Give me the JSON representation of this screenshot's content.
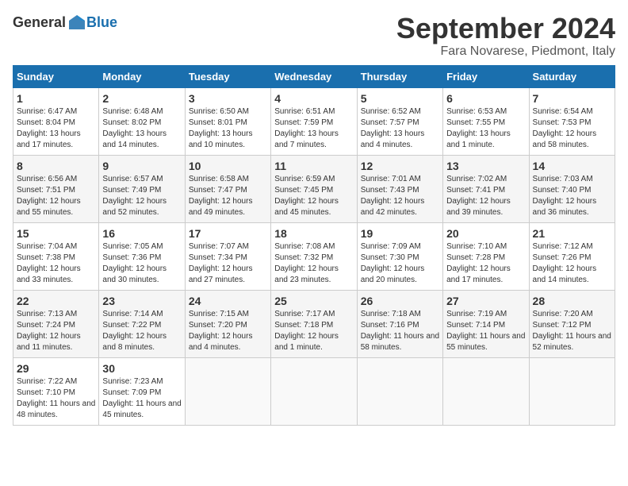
{
  "header": {
    "logo_general": "General",
    "logo_blue": "Blue",
    "month": "September 2024",
    "location": "Fara Novarese, Piedmont, Italy"
  },
  "columns": [
    "Sunday",
    "Monday",
    "Tuesday",
    "Wednesday",
    "Thursday",
    "Friday",
    "Saturday"
  ],
  "weeks": [
    [
      {
        "day": "1",
        "sunrise": "6:47 AM",
        "sunset": "8:04 PM",
        "daylight": "13 hours and 17 minutes."
      },
      {
        "day": "2",
        "sunrise": "6:48 AM",
        "sunset": "8:02 PM",
        "daylight": "13 hours and 14 minutes."
      },
      {
        "day": "3",
        "sunrise": "6:50 AM",
        "sunset": "8:01 PM",
        "daylight": "13 hours and 10 minutes."
      },
      {
        "day": "4",
        "sunrise": "6:51 AM",
        "sunset": "7:59 PM",
        "daylight": "13 hours and 7 minutes."
      },
      {
        "day": "5",
        "sunrise": "6:52 AM",
        "sunset": "7:57 PM",
        "daylight": "13 hours and 4 minutes."
      },
      {
        "day": "6",
        "sunrise": "6:53 AM",
        "sunset": "7:55 PM",
        "daylight": "13 hours and 1 minute."
      },
      {
        "day": "7",
        "sunrise": "6:54 AM",
        "sunset": "7:53 PM",
        "daylight": "12 hours and 58 minutes."
      }
    ],
    [
      {
        "day": "8",
        "sunrise": "6:56 AM",
        "sunset": "7:51 PM",
        "daylight": "12 hours and 55 minutes."
      },
      {
        "day": "9",
        "sunrise": "6:57 AM",
        "sunset": "7:49 PM",
        "daylight": "12 hours and 52 minutes."
      },
      {
        "day": "10",
        "sunrise": "6:58 AM",
        "sunset": "7:47 PM",
        "daylight": "12 hours and 49 minutes."
      },
      {
        "day": "11",
        "sunrise": "6:59 AM",
        "sunset": "7:45 PM",
        "daylight": "12 hours and 45 minutes."
      },
      {
        "day": "12",
        "sunrise": "7:01 AM",
        "sunset": "7:43 PM",
        "daylight": "12 hours and 42 minutes."
      },
      {
        "day": "13",
        "sunrise": "7:02 AM",
        "sunset": "7:41 PM",
        "daylight": "12 hours and 39 minutes."
      },
      {
        "day": "14",
        "sunrise": "7:03 AM",
        "sunset": "7:40 PM",
        "daylight": "12 hours and 36 minutes."
      }
    ],
    [
      {
        "day": "15",
        "sunrise": "7:04 AM",
        "sunset": "7:38 PM",
        "daylight": "12 hours and 33 minutes."
      },
      {
        "day": "16",
        "sunrise": "7:05 AM",
        "sunset": "7:36 PM",
        "daylight": "12 hours and 30 minutes."
      },
      {
        "day": "17",
        "sunrise": "7:07 AM",
        "sunset": "7:34 PM",
        "daylight": "12 hours and 27 minutes."
      },
      {
        "day": "18",
        "sunrise": "7:08 AM",
        "sunset": "7:32 PM",
        "daylight": "12 hours and 23 minutes."
      },
      {
        "day": "19",
        "sunrise": "7:09 AM",
        "sunset": "7:30 PM",
        "daylight": "12 hours and 20 minutes."
      },
      {
        "day": "20",
        "sunrise": "7:10 AM",
        "sunset": "7:28 PM",
        "daylight": "12 hours and 17 minutes."
      },
      {
        "day": "21",
        "sunrise": "7:12 AM",
        "sunset": "7:26 PM",
        "daylight": "12 hours and 14 minutes."
      }
    ],
    [
      {
        "day": "22",
        "sunrise": "7:13 AM",
        "sunset": "7:24 PM",
        "daylight": "12 hours and 11 minutes."
      },
      {
        "day": "23",
        "sunrise": "7:14 AM",
        "sunset": "7:22 PM",
        "daylight": "12 hours and 8 minutes."
      },
      {
        "day": "24",
        "sunrise": "7:15 AM",
        "sunset": "7:20 PM",
        "daylight": "12 hours and 4 minutes."
      },
      {
        "day": "25",
        "sunrise": "7:17 AM",
        "sunset": "7:18 PM",
        "daylight": "12 hours and 1 minute."
      },
      {
        "day": "26",
        "sunrise": "7:18 AM",
        "sunset": "7:16 PM",
        "daylight": "11 hours and 58 minutes."
      },
      {
        "day": "27",
        "sunrise": "7:19 AM",
        "sunset": "7:14 PM",
        "daylight": "11 hours and 55 minutes."
      },
      {
        "day": "28",
        "sunrise": "7:20 AM",
        "sunset": "7:12 PM",
        "daylight": "11 hours and 52 minutes."
      }
    ],
    [
      {
        "day": "29",
        "sunrise": "7:22 AM",
        "sunset": "7:10 PM",
        "daylight": "11 hours and 48 minutes."
      },
      {
        "day": "30",
        "sunrise": "7:23 AM",
        "sunset": "7:09 PM",
        "daylight": "11 hours and 45 minutes."
      },
      null,
      null,
      null,
      null,
      null
    ]
  ]
}
